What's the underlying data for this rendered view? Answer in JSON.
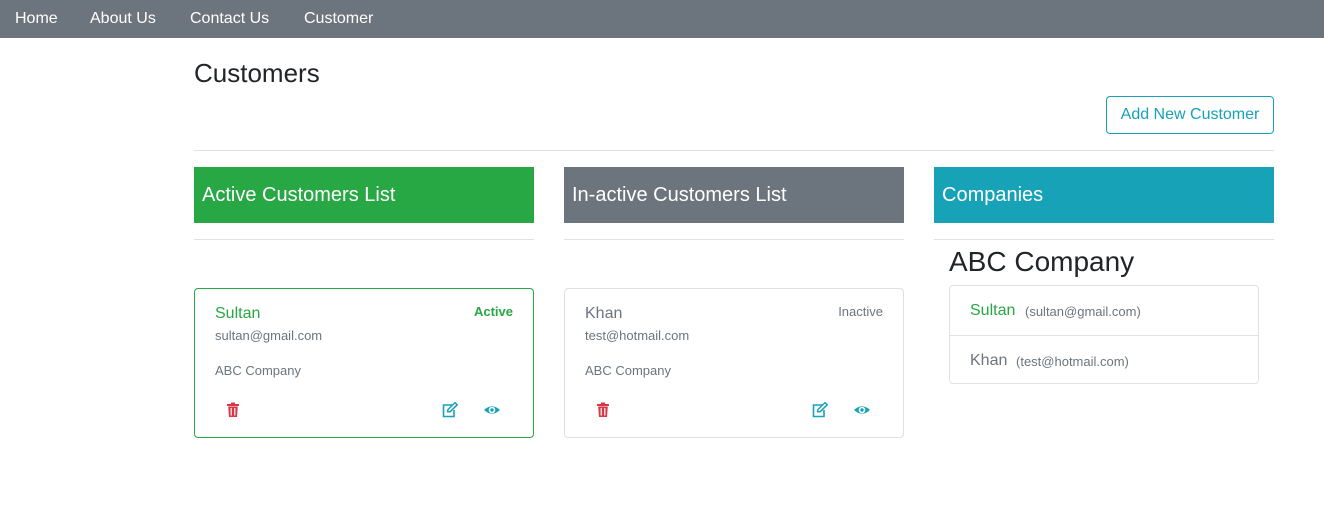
{
  "navbar": {
    "items": [
      {
        "label": "Home"
      },
      {
        "label": "About Us"
      },
      {
        "label": "Contact Us"
      },
      {
        "label": "Customer"
      }
    ]
  },
  "page": {
    "title": "Customers",
    "add_button_label": "Add New Customer"
  },
  "columns": {
    "active": {
      "title": "Active Customers List",
      "color": "#28a745"
    },
    "inactive": {
      "title": "In-active Customers List",
      "color": "#6c757d"
    },
    "companies": {
      "title": "Companies",
      "color": "#17a2b8"
    }
  },
  "active_customers": [
    {
      "name": "Sultan",
      "email": "sultan@gmail.com",
      "company": "ABC Company",
      "status": "Active"
    }
  ],
  "inactive_customers": [
    {
      "name": "Khan",
      "email": "test@hotmail.com",
      "company": "ABC Company",
      "status": "Inactive"
    }
  ],
  "companies": [
    {
      "name": "ABC Company",
      "customers": [
        {
          "name": "Sultan",
          "email": "(sultan@gmail.com)",
          "status": "active"
        },
        {
          "name": "Khan",
          "email": "(test@hotmail.com)",
          "status": "inactive"
        }
      ]
    }
  ],
  "icons": {
    "delete": "trash-icon",
    "edit": "edit-icon",
    "view": "eye-icon"
  },
  "colors": {
    "navbar": "#6c757d",
    "success": "#28a745",
    "info": "#17a2b8",
    "danger": "#dc3545",
    "secondary": "#6c757d"
  }
}
